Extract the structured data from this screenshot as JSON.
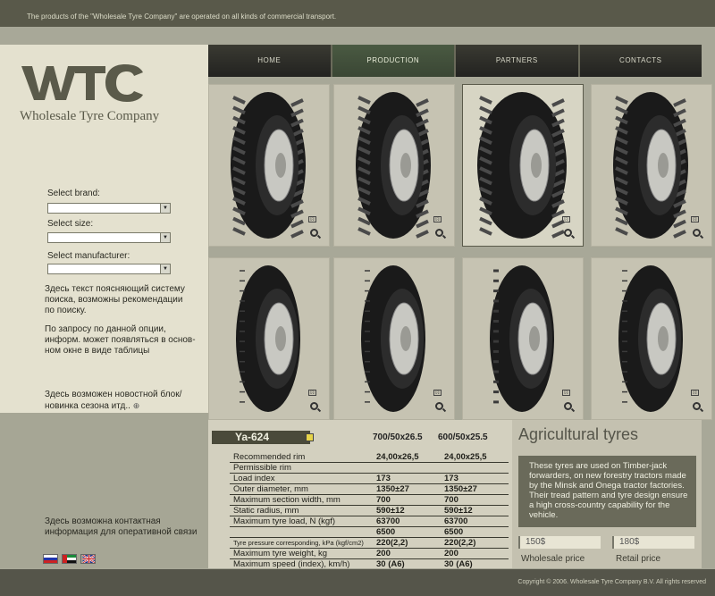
{
  "header": {
    "tagline": "The products of the \"Wholesale Tyre Company\" are operated on all kinds of commercial transport."
  },
  "logo": {
    "mark": "WTC",
    "name": "Wholesale Tyre Company"
  },
  "nav": {
    "items": [
      "HOME",
      "PRODUCTION",
      "PARTNERS",
      "CONTACTS"
    ],
    "active": 1
  },
  "search": {
    "brand_label": "Select brand:",
    "size_label": "Select size:",
    "manufacturer_label": "Select manufacturer:",
    "brand_value": "",
    "size_value": "",
    "manufacturer_value": ""
  },
  "sidebar": {
    "search_note": [
      "Здесь текст поясняющий систему",
      "поиска, возможны рекомендации",
      "по поиску."
    ],
    "request_note": [
      "По запросу по данной опции,",
      "информ. может появляться в основ-",
      "ном окне в виде таблицы"
    ],
    "news_note": [
      "Здесь возможен новостной блок/",
      "новинка сезона итд.."
    ],
    "news_more": "⊕",
    "contact_note": [
      "Здесь возможна  контактная",
      "информация для оперативной связи"
    ]
  },
  "flags": [
    {
      "name": "russian-flag",
      "colors": [
        "#ffffff",
        "#2233aa",
        "#cc2222"
      ]
    },
    {
      "name": "uae-flag",
      "colors": [
        "#1a8a3a",
        "#ffffff",
        "#111111"
      ]
    },
    {
      "name": "uk-flag",
      "colors": [
        "#223388",
        "#cc2222",
        "#223388"
      ]
    }
  ],
  "tyres": {
    "top": [
      "agricultural",
      "agricultural",
      "flotation",
      "agricultural"
    ],
    "bottom": [
      "highway",
      "highway",
      "winter",
      "highway"
    ],
    "selected": 2,
    "enlarge_symbol": "[:]"
  },
  "spec": {
    "model": "Ya-624",
    "sizes": [
      "700/50x26.5",
      "600/50x25.5"
    ],
    "rows": [
      {
        "label": "Recommended rim",
        "v1": "24,00x26,5",
        "v2": "24,00x25,5"
      },
      {
        "label": "Permissible rim",
        "v1": "",
        "v2": ""
      },
      {
        "label": "Load index",
        "v1": "173",
        "v2": "173"
      },
      {
        "label": "Outer diameter, mm",
        "v1": "1350±27",
        "v2": "1350±27"
      },
      {
        "label": "Maximum section width, mm",
        "v1": "700",
        "v2": "700"
      },
      {
        "label": "Static radius, mm",
        "v1": "590±12",
        "v2": "590±12"
      },
      {
        "label": "Maximum tyre load, N (kgf)",
        "v1": "63700",
        "v2": "63700"
      },
      {
        "label": "",
        "v1": "6500",
        "v2": "6500"
      },
      {
        "label": "Tyre pressure corresponding, kPa (kgf/cm2)",
        "v1": "220(2,2)",
        "v2": "220(2,2)",
        "small": true
      },
      {
        "label": "Maximum tyre weight, kg",
        "v1": "200",
        "v2": "200"
      },
      {
        "label": "Maximum speed (index), km/h)",
        "v1": "30 (A6)",
        "v2": "30 (A6)"
      }
    ]
  },
  "description": {
    "title": "Agricultural tyres",
    "text": "These tyres are used on Timber-jack forwarders, on new forestry  tractors made by the Minsk and Onega tractor factories. Their tread pattern and tyre design ensure a high cross-country capability for the vehicle.",
    "wholesale_value": "150$",
    "wholesale_label": "Wholesale price",
    "retail_value": "180$",
    "retail_label": "Retail price"
  },
  "footer": {
    "copyright": "Copyright ©  2006.  Wholesale Tyre Company B.V.  All rights reserved"
  }
}
